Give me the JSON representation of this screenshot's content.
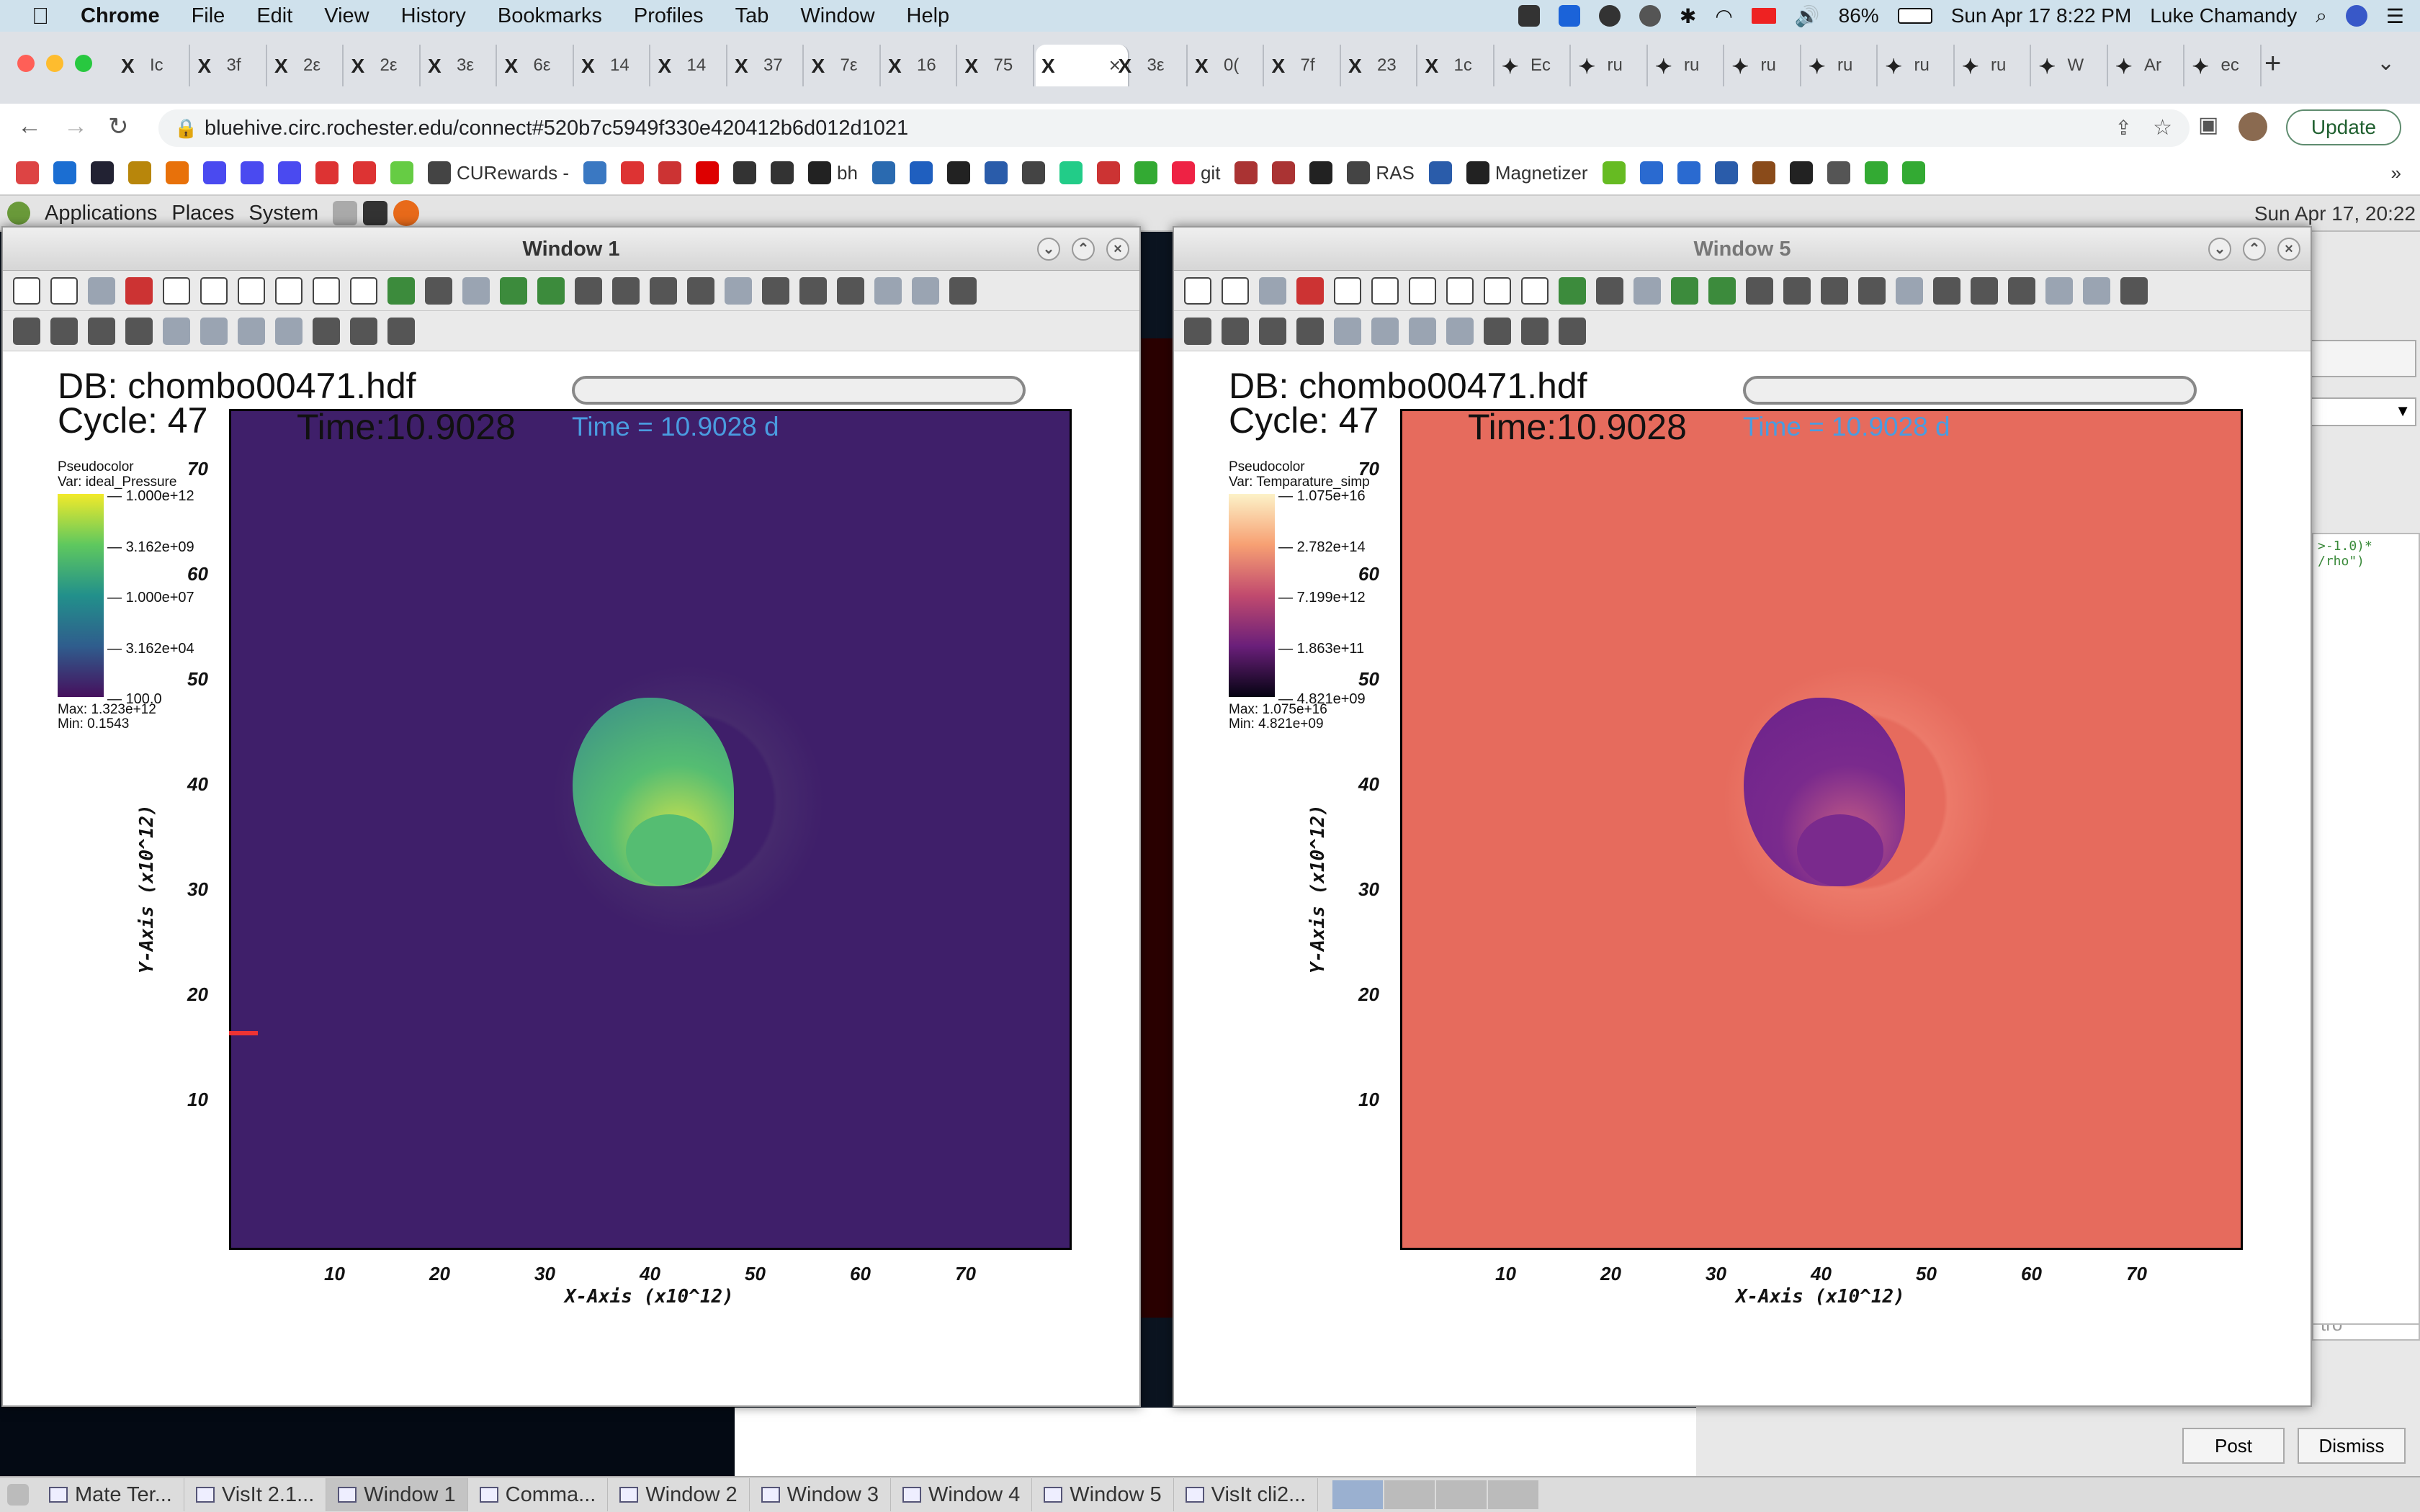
{
  "mac_menu": {
    "app": "Chrome",
    "items": [
      "File",
      "Edit",
      "View",
      "History",
      "Bookmarks",
      "Profiles",
      "Tab",
      "Window",
      "Help"
    ],
    "battery": "86%",
    "clock": "Sun Apr 17  8:22 PM",
    "user": "Luke Chamandy"
  },
  "chrome": {
    "tabs": [
      "Ic",
      "3f",
      "2ε",
      "2ε",
      "3ε",
      "6ε",
      "14",
      "14",
      "37",
      "7ε",
      "16",
      "75",
      "",
      "3ε",
      "0(",
      "7f",
      "23",
      "1c",
      "Ec",
      "ru",
      "ru",
      "ru",
      "ru",
      "ru",
      "ru",
      "W",
      "Ar",
      "ec"
    ],
    "active_tab_index": 12,
    "url": "bluehive.circ.rochester.edu/connect#520b7c5949f330e420412b6d012d1021",
    "update_label": "Update",
    "bookmarks": [
      {
        "label": "",
        "color": "#d44"
      },
      {
        "label": "",
        "color": "#1b6ed2"
      },
      {
        "label": "",
        "color": "#223"
      },
      {
        "label": "",
        "color": "#b8860b"
      },
      {
        "label": "",
        "color": "#e8710a"
      },
      {
        "label": "",
        "color": "#4a4af0"
      },
      {
        "label": "",
        "color": "#4a4af0"
      },
      {
        "label": "",
        "color": "#4a4af0"
      },
      {
        "label": "",
        "color": "#d33"
      },
      {
        "label": "",
        "color": "#d33"
      },
      {
        "label": "",
        "color": "#6c4"
      },
      {
        "label": "CURewards -",
        "color": "#444"
      },
      {
        "label": "",
        "color": "#3a78c2"
      },
      {
        "label": "",
        "color": "#d33"
      },
      {
        "label": "",
        "color": "#c33"
      },
      {
        "label": "",
        "color": "#d00"
      },
      {
        "label": "",
        "color": "#333"
      },
      {
        "label": "",
        "color": "#333"
      },
      {
        "label": "bh",
        "color": "#222"
      },
      {
        "label": "",
        "color": "#2a6ab0"
      },
      {
        "label": "",
        "color": "#1f5fbf"
      },
      {
        "label": "",
        "color": "#222"
      },
      {
        "label": "",
        "color": "#2a5caa"
      },
      {
        "label": "",
        "color": "#444"
      },
      {
        "label": "",
        "color": "#2c8"
      },
      {
        "label": "",
        "color": "#c33"
      },
      {
        "label": "",
        "color": "#3a3"
      },
      {
        "label": "git",
        "color": "#e24"
      },
      {
        "label": "",
        "color": "#a33"
      },
      {
        "label": "",
        "color": "#a33"
      },
      {
        "label": "",
        "color": "#222"
      },
      {
        "label": "RAS",
        "color": "#444"
      },
      {
        "label": "",
        "color": "#2a5caa"
      },
      {
        "label": "Magnetizer",
        "color": "#222"
      },
      {
        "label": "",
        "color": "#6b2"
      },
      {
        "label": "",
        "color": "#2a6ad0"
      },
      {
        "label": "",
        "color": "#2a6ad0"
      },
      {
        "label": "",
        "color": "#2a5caa"
      },
      {
        "label": "",
        "color": "#8a4b1a"
      },
      {
        "label": "",
        "color": "#222"
      },
      {
        "label": "",
        "color": "#555"
      },
      {
        "label": "",
        "color": "#3a3"
      },
      {
        "label": "",
        "color": "#3a3"
      }
    ]
  },
  "mate": {
    "menus": [
      "Applications",
      "Places",
      "System"
    ],
    "clock": "Sun Apr 17, 20:22"
  },
  "dialog": {
    "post": "Post",
    "dismiss": "Dismiss",
    "code_lines": [
      ">-1.0)*",
      "/rho\")"
    ],
    "tail": "tro"
  },
  "windows": [
    {
      "title": "Window 1",
      "db": "DB: chombo00471.hdf",
      "cycle": "Cycle: 47",
      "time_black": "Time:10.9028",
      "time_blue": "Time = 10.9028 d",
      "legend_type": "Pseudocolor",
      "legend_var": "Var: ideal_Pressure",
      "ticks": [
        "1.000e+12",
        "3.162e+09",
        "1.000e+07",
        "3.162e+04",
        "100.0"
      ],
      "max": "Max:  1.323e+12",
      "min": "Min:  0.1543",
      "bg": "#3f1f6a",
      "cbar": [
        "#f2ea2a",
        "#5fc85e",
        "#22908b",
        "#2f5d8d",
        "#46105d"
      ],
      "blob": [
        "#c9e14e",
        "#55bd72",
        "#3a8b8b"
      ],
      "halo": "#462a6d"
    },
    {
      "title": "Window 5",
      "db": "DB: chombo00471.hdf",
      "cycle": "Cycle: 47",
      "time_black": "Time:10.9028",
      "time_blue": "Time = 10.9028 d",
      "legend_type": "Pseudocolor",
      "legend_var": "Var: Temparature_simp",
      "ticks": [
        "1.075e+16",
        "2.782e+14",
        "7.199e+12",
        "1.863e+11",
        "4.821e+09"
      ],
      "max": "Max:  1.075e+16",
      "min": "Min:  4.821e+09",
      "bg": "#e66b5d",
      "cbar": [
        "#fcf2c8",
        "#f7a073",
        "#c14a6e",
        "#6a1f7a",
        "#050312"
      ],
      "blob": [
        "#c25a86",
        "#7a2a8d",
        "#6b228c"
      ],
      "halo": "#ec7a6a"
    }
  ],
  "axes": {
    "x_label": "X-Axis  (x10^12)",
    "y_label": "Y-Axis  (x10^12)",
    "x_ticks": [
      "10",
      "20",
      "30",
      "40",
      "50",
      "60",
      "70"
    ],
    "y_ticks": [
      "70",
      "60",
      "50",
      "40",
      "30",
      "20",
      "10"
    ]
  },
  "taskbar": [
    {
      "label": "Mate Ter...",
      "active": false
    },
    {
      "label": "VisIt 2.1...",
      "active": false
    },
    {
      "label": "Window 1",
      "active": true
    },
    {
      "label": "Comma...",
      "active": false
    },
    {
      "label": "Window 2",
      "active": false
    },
    {
      "label": "Window 3",
      "active": false
    },
    {
      "label": "Window 4",
      "active": false
    },
    {
      "label": "Window 5",
      "active": false
    },
    {
      "label": "VisIt cli2...",
      "active": false
    }
  ]
}
